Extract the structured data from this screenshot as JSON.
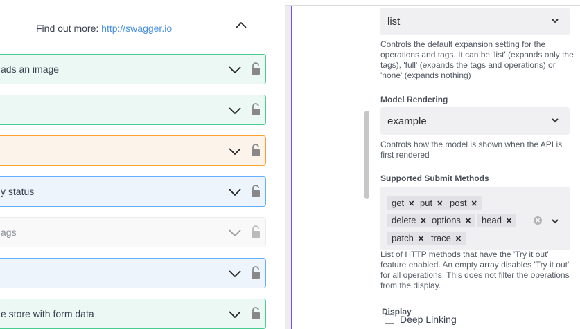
{
  "info": {
    "prefix": "Find out more:",
    "link": "http://swagger.io"
  },
  "operations": [
    {
      "label": "ads an image",
      "method": "post"
    },
    {
      "label": "",
      "method": "post"
    },
    {
      "label": "",
      "method": "put"
    },
    {
      "label": "y status",
      "method": "get"
    },
    {
      "label": "ags",
      "method": "deprecated"
    },
    {
      "label": "",
      "method": "get"
    },
    {
      "label": "e store with form data",
      "method": "post"
    }
  ],
  "settings": {
    "doc_expansion": {
      "value": "list",
      "description": "Controls the default expansion setting for the operations and tags. It can be 'list' (expands only the tags), 'full' (expands the tags and operations) or 'none' (expands nothing)"
    },
    "model_rendering": {
      "label": "Model Rendering",
      "value": "example",
      "description": "Controls how the model is shown when the API is first rendered"
    },
    "submit_methods": {
      "label": "Supported Submit Methods",
      "chips": [
        "get",
        "put",
        "post",
        "delete",
        "options",
        "head",
        "patch",
        "trace"
      ],
      "description": "List of HTTP methods that have the 'Try it out' feature enabled. An empty array disables 'Try it out' for all operations. This does not filter the operations from the display."
    },
    "display": {
      "label": "Display",
      "deep_linking": "Deep Linking"
    }
  },
  "colors": {
    "accent": "#7c4dff",
    "post": "#49cc90",
    "put": "#fca130",
    "get": "#61affe",
    "link": "#4990e2"
  }
}
